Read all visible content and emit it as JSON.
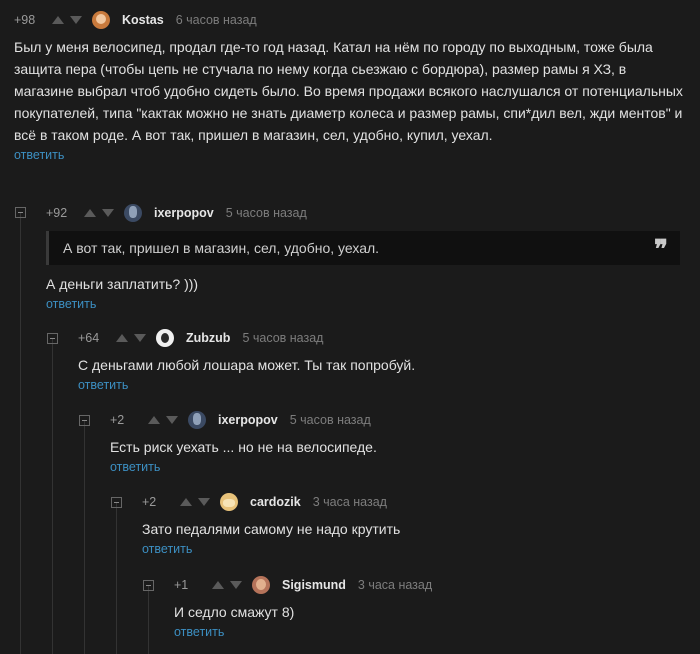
{
  "comments": [
    {
      "rating": "+98",
      "username": "Kostas",
      "time": "6 часов назад",
      "text": "Был у меня велосипед, продал где-то год назад. Катал на нём по городу по выходным, тоже была защита пера (чтобы цепь не стучала по нему когда сьезжаю с бордюра), размер рамы я ХЗ, в магазине выбрал чтоб удобно сидеть было. Во время продажи всякого наслушался от потенциальных покупателей, типа \"кактак можно не знать диаметр колеса и размер рамы, спи*дил вел, жди ментов\" и всё в таком роде. А вот так, пришел в магазин, сел, удобно, купил, уехал.",
      "reply": "ответить",
      "avatar_color": "#c97a3c"
    },
    {
      "rating": "+92",
      "username": "ixerpopov",
      "time": "5 часов назад",
      "quote": "А вот так, пришел в магазин, сел, удобно, уехал.",
      "quote_icon": "❞",
      "text": "А деньги заплатить? )))",
      "reply": "ответить",
      "avatar_color": "#3b4a63"
    },
    {
      "rating": "+64",
      "username": "Zubzub",
      "time": "5 часов назад",
      "text": "С деньгами любой лошара может. Ты так попробуй.",
      "reply": "ответить",
      "avatar_color": "#f0f0f0"
    },
    {
      "rating": "+2",
      "username": "ixerpopov",
      "time": "5 часов назад",
      "text": "Есть риск уехать ... но не на велосипеде.",
      "reply": "ответить",
      "avatar_color": "#3b4a63"
    },
    {
      "rating": "+2",
      "username": "cardozik",
      "time": "3 часа назад",
      "text": "Зато педалями самому не надо крутить",
      "reply": "ответить",
      "avatar_color": "#e8c27a"
    },
    {
      "rating": "+1",
      "username": "Sigismund",
      "time": "3 часа назад",
      "text": "И седло смажут 8)",
      "reply": "ответить",
      "avatar_color": "#b5735a"
    }
  ]
}
